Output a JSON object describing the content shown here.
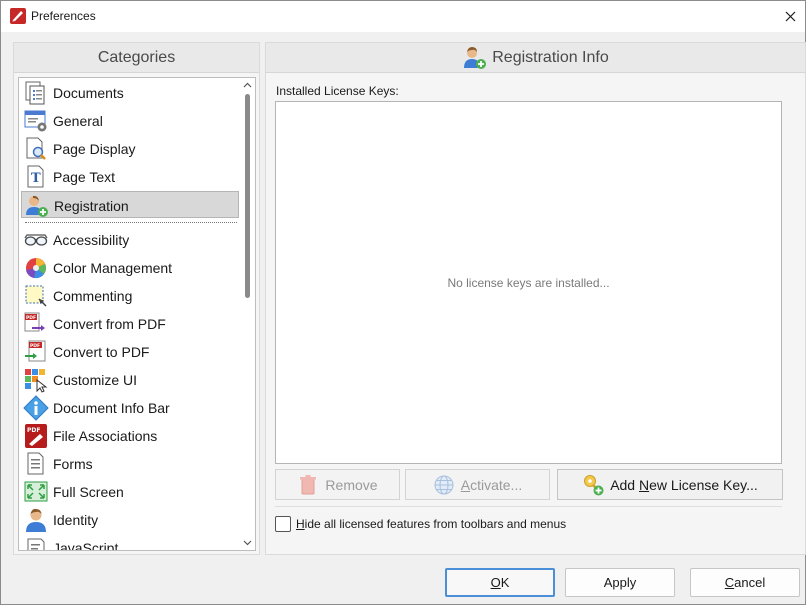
{
  "window": {
    "title": "Preferences",
    "close_glyph": "✕"
  },
  "categories": {
    "header": "Categories",
    "items": [
      {
        "label": "Documents",
        "icon": "documents-icon"
      },
      {
        "label": "General",
        "icon": "general-icon"
      },
      {
        "label": "Page Display",
        "icon": "page-display-icon"
      },
      {
        "label": "Page Text",
        "icon": "page-text-icon"
      },
      {
        "label": "Registration",
        "icon": "registration-icon",
        "selected": true
      },
      {
        "label": "Accessibility",
        "icon": "accessibility-icon"
      },
      {
        "label": "Color Management",
        "icon": "color-management-icon"
      },
      {
        "label": "Commenting",
        "icon": "commenting-icon"
      },
      {
        "label": "Convert from PDF",
        "icon": "convert-from-pdf-icon"
      },
      {
        "label": "Convert to PDF",
        "icon": "convert-to-pdf-icon"
      },
      {
        "label": "Customize UI",
        "icon": "customize-ui-icon"
      },
      {
        "label": "Document Info Bar",
        "icon": "document-info-bar-icon"
      },
      {
        "label": "File Associations",
        "icon": "file-associations-icon"
      },
      {
        "label": "Forms",
        "icon": "forms-icon"
      },
      {
        "label": "Full Screen",
        "icon": "full-screen-icon"
      },
      {
        "label": "Identity",
        "icon": "identity-icon"
      },
      {
        "label": "JavaScript",
        "icon": "javascript-icon"
      }
    ]
  },
  "registration": {
    "header": "Registration Info",
    "installed_label": "Installed License Keys:",
    "empty_text": "No license keys are installed...",
    "remove_label": "Remove",
    "activate_label": "Activate...",
    "add_key_label": "Add New License Key...",
    "hide_features_label": "Hide all licensed features from toolbars and menus",
    "hide_features_checked": false
  },
  "dialog_buttons": {
    "ok": "OK",
    "apply": "Apply",
    "cancel": "Cancel"
  },
  "colors": {
    "selection": "#d8d8d8",
    "default_button_border": "#4a8fd8",
    "pdf_red": "#c62828"
  }
}
